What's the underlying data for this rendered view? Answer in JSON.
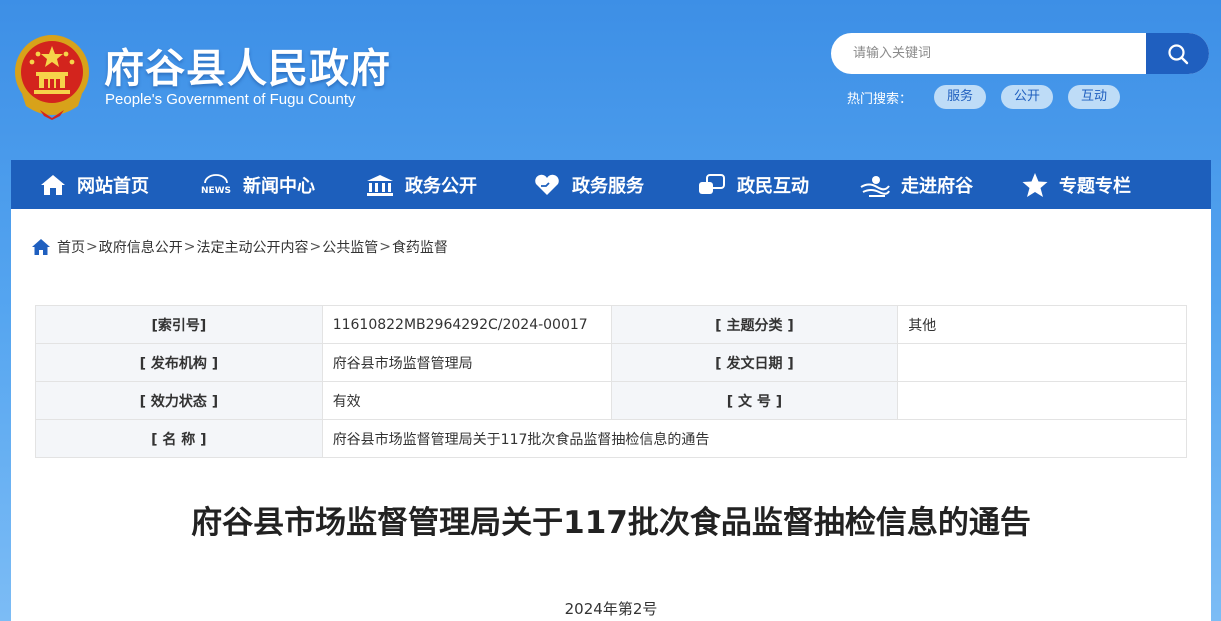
{
  "site": {
    "title": "府谷县人民政府",
    "subtitle": "People's Government of Fugu County"
  },
  "search": {
    "placeholder": "请输入关键词",
    "hot_label": "热门搜索：",
    "hot_tags": [
      "服务",
      "公开",
      "互动"
    ]
  },
  "nav": {
    "items": [
      {
        "label": "网站首页",
        "icon": "home-icon"
      },
      {
        "label": "新闻中心",
        "icon": "news-icon"
      },
      {
        "label": "政务公开",
        "icon": "government-building-icon"
      },
      {
        "label": "政务服务",
        "icon": "heart-hand-icon"
      },
      {
        "label": "政民互动",
        "icon": "chat-icon"
      },
      {
        "label": "走进府谷",
        "icon": "landscape-icon"
      },
      {
        "label": "专题专栏",
        "icon": "star-icon"
      }
    ]
  },
  "breadcrumb": {
    "items": [
      "首页",
      "政府信息公开",
      "法定主动公开内容",
      "公共监管",
      "食药监督"
    ],
    "separator": ">"
  },
  "meta": {
    "index_label": "[索引号]",
    "index_value": "11610822MB2964292C/2024-00017",
    "topic_label": "[ 主题分类 ]",
    "topic_value": "其他",
    "publisher_label": "[ 发布机构 ]",
    "publisher_value": "府谷县市场监督管理局",
    "date_label": "[ 发文日期 ]",
    "date_value": "",
    "status_label": "[ 效力状态 ]",
    "status_value": "有效",
    "docno_label": "[ 文 号 ]",
    "docno_value": "",
    "name_label": "[ 名 称 ]",
    "name_value": "府谷县市场监督管理局关于117批次食品监督抽检信息的通告"
  },
  "document": {
    "title": "府谷县市场监督管理局关于117批次食品监督抽检信息的通告",
    "number": "2024年第2号"
  },
  "colors": {
    "nav_bg": "#1d5fbc",
    "accent": "#1f5fbf",
    "header_gradient_top": "#3d8fe6"
  }
}
